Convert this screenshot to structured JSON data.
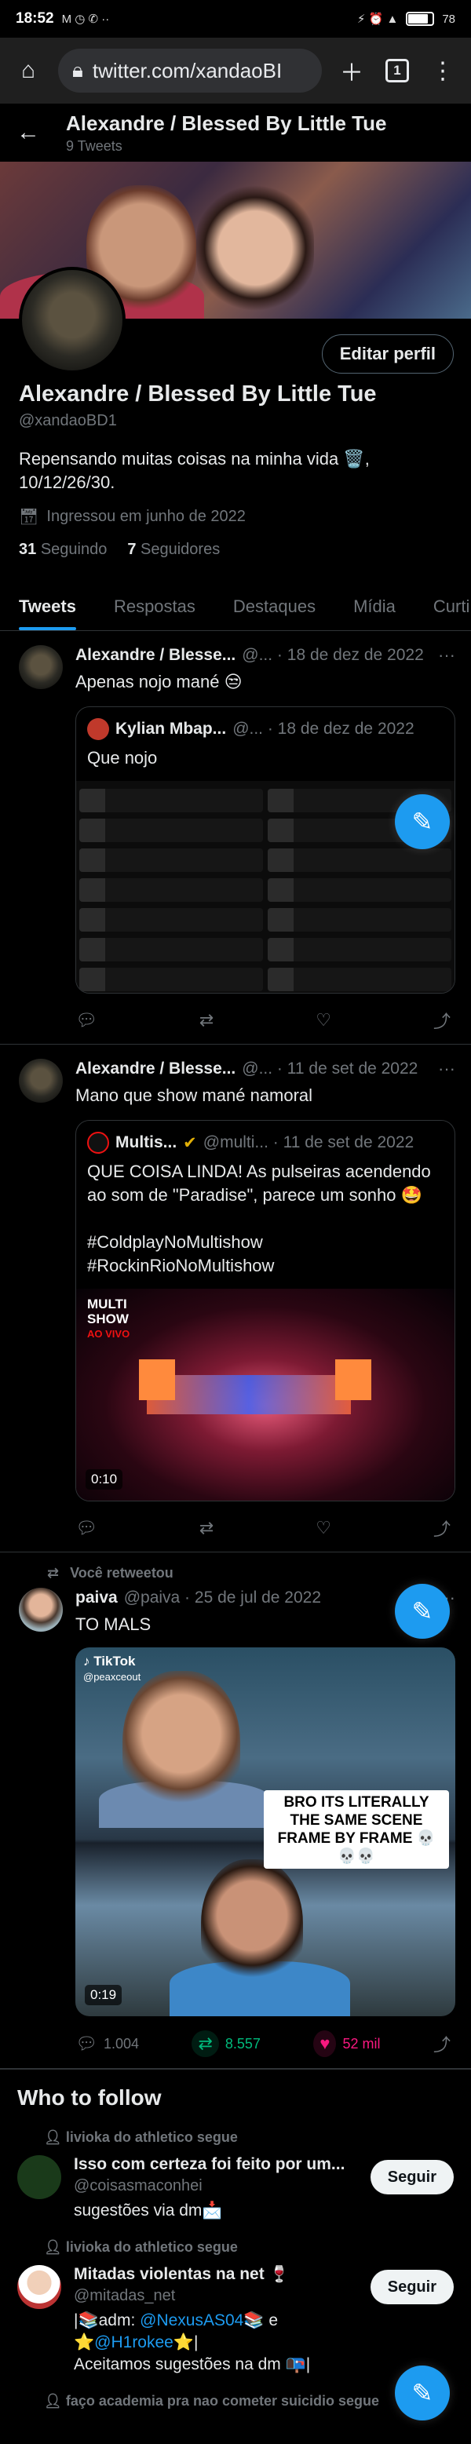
{
  "status_bar": {
    "time": "18:52",
    "left_icons": "M ◷ ✆ ··",
    "right_icons": "⚡ ⏰ ▲",
    "battery": "78"
  },
  "browser": {
    "url": "twitter.com/xandaoBI",
    "tab_count": "1"
  },
  "header": {
    "title": "Alexandre / Blessed By Little Tue",
    "tweet_count": "9 Tweets"
  },
  "profile": {
    "edit_label": "Editar perfil",
    "name": "Alexandre / Blessed By Little Tue",
    "handle": "@xandaoBD1",
    "bio": "Repensando muitas coisas na minha vida 🗑️,\n10/12/26/30.",
    "joined": "Ingressou em junho de 2022",
    "following_count": "31",
    "following_label": "Seguindo",
    "followers_count": "7",
    "followers_label": "Seguidores"
  },
  "tabs": [
    "Tweets",
    "Respostas",
    "Destaques",
    "Mídia",
    "Curti"
  ],
  "tweets": [
    {
      "name": "Alexandre / Blesse...",
      "meta": "@... · 18 de dez de 2022",
      "text": "Apenas nojo mané 😒",
      "quote": {
        "name": "Kylian Mbap...",
        "meta": "@... · 18 de dez de 2022",
        "text": "Que nojo"
      }
    },
    {
      "name": "Alexandre / Blesse...",
      "meta": "@... · 11 de set de 2022",
      "text": "Mano que show mané namoral",
      "quote": {
        "name": "Multis...",
        "meta": "@multi... · 11 de set de 2022",
        "text": "QUE COISA LINDA! As pulseiras acendendo ao som de \"Paradise\", parece um sonho 🤩\n\n#ColdplayNoMultishow\n#RockinRioNoMultishow",
        "logo_line1": "MULTI",
        "logo_line2": "SHOW",
        "logo_line3": "AO VIVO",
        "duration": "0:10"
      }
    },
    {
      "retweet_label": "Você retweetou",
      "name": "paiva",
      "meta": "@paiva · 25 de jul de 2022",
      "text": "TO MALS",
      "video": {
        "brand": "TikTok",
        "brand_handle": "@peaxceout",
        "caption": "BRO ITS LITERALLY THE SAME SCENE FRAME BY FRAME 💀💀💀",
        "duration": "0:19"
      },
      "replies": "1.004",
      "retweets": "8.557",
      "likes": "52 mil"
    }
  ],
  "who_to_follow": {
    "title": "Who to follow",
    "follow_label": "Seguir",
    "items": [
      {
        "social": "livioka do athletico segue",
        "name": "Isso com certeza foi feito por um...",
        "handle": "@coisasmaconhei",
        "bio": "sugestões via dm📩"
      },
      {
        "social": "livioka do athletico segue",
        "name": "Mitadas violentas na net 🍷",
        "handle": "@mitadas_net",
        "bio_prefix": "|📚adm: ",
        "mention1": "@NexusAS04",
        "bio_mid": "📚 e ⭐",
        "mention2": "@H1rokee",
        "bio_end": "⭐|\nAceitamos sugestões na dm 📭|"
      },
      {
        "social": "faço academia pra nao cometer suicidio segue"
      }
    ]
  }
}
